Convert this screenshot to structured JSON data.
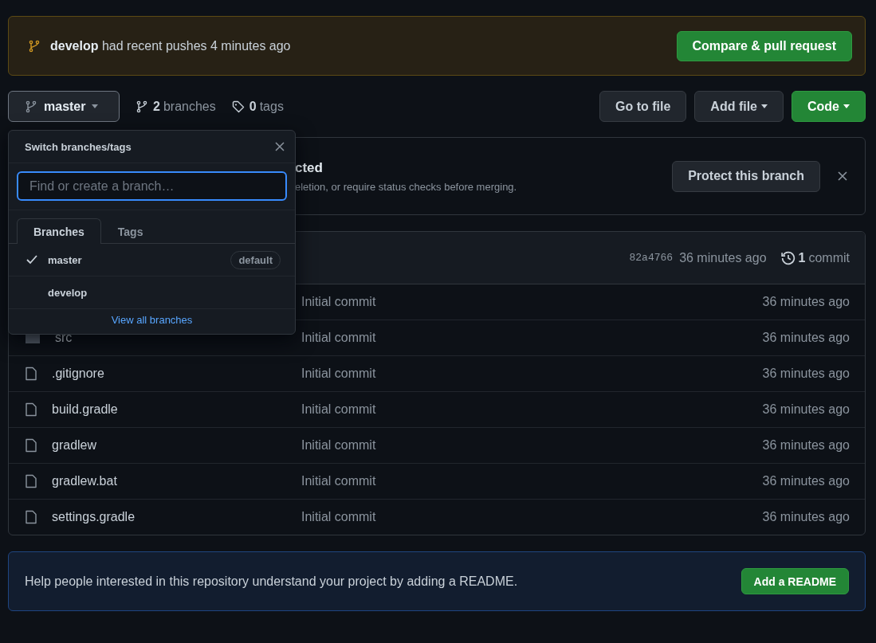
{
  "push_banner": {
    "branch": "develop",
    "message": "had recent pushes 4 minutes ago",
    "button": "Compare & pull request"
  },
  "toolbar": {
    "branch_button": "master",
    "branch_count": "2",
    "branch_label": "branches",
    "tag_count": "0",
    "tag_label": "tags",
    "buttons": [
      {
        "label": "Go to file",
        "kind": "plain"
      },
      {
        "label": "Add file",
        "kind": "menu"
      },
      {
        "label": "Code",
        "kind": "primary"
      }
    ]
  },
  "protect_banner": {
    "title": "cted",
    "text": "eletion, or require status checks before merging.",
    "button": "Protect this branch"
  },
  "commit_bar": {
    "sha": "82a4766",
    "time": "36 minutes ago",
    "count": "1",
    "count_label": "commit"
  },
  "files": [
    {
      "kind": "covered",
      "message": "Initial commit",
      "time": "36 minutes ago"
    },
    {
      "kind": "folder",
      "name": "src",
      "message": "Initial commit",
      "time": "36 minutes ago"
    },
    {
      "kind": "file",
      "name": ".gitignore",
      "message": "Initial commit",
      "time": "36 minutes ago"
    },
    {
      "kind": "file",
      "name": "build.gradle",
      "message": "Initial commit",
      "time": "36 minutes ago"
    },
    {
      "kind": "file",
      "name": "gradlew",
      "message": "Initial commit",
      "time": "36 minutes ago"
    },
    {
      "kind": "file",
      "name": "gradlew.bat",
      "message": "Initial commit",
      "time": "36 minutes ago"
    },
    {
      "kind": "file",
      "name": "settings.gradle",
      "message": "Initial commit",
      "time": "36 minutes ago"
    }
  ],
  "dropdown": {
    "title": "Switch branches/tags",
    "search": {
      "placeholder": "Find or create a branch…"
    },
    "tabs": [
      {
        "label": "Branches",
        "selected": true
      },
      {
        "label": "Tags",
        "selected": false
      }
    ],
    "branches": [
      {
        "name": "master",
        "selected": true,
        "badge": "default"
      },
      {
        "name": "develop",
        "selected": false
      }
    ],
    "link": "View all branches"
  },
  "readme": {
    "text": "Help people interested in this repository understand your project by adding a README.",
    "button": "Add a README"
  }
}
